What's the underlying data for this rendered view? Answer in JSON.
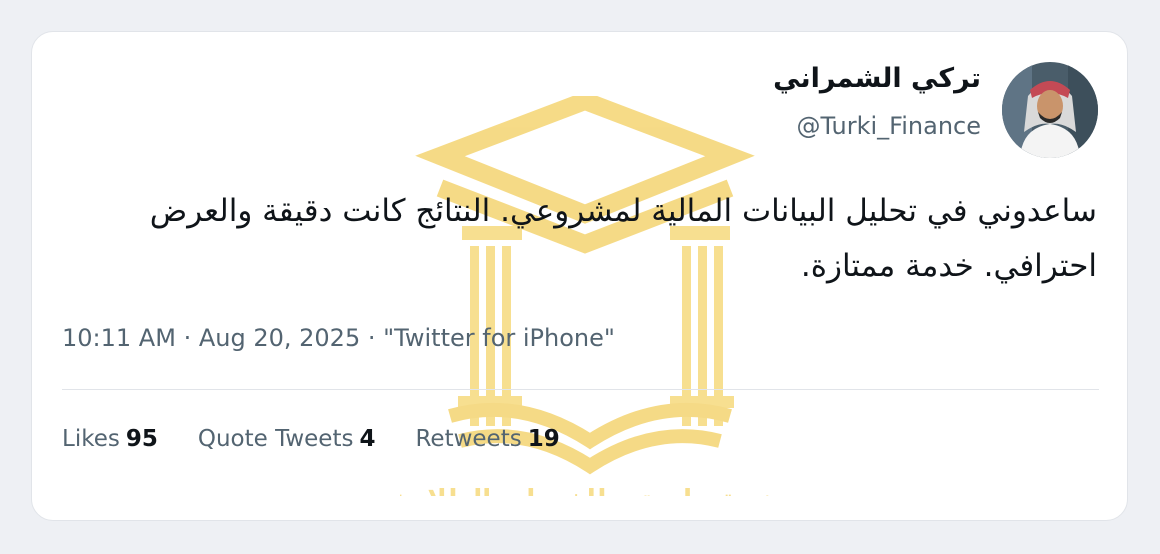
{
  "tweet": {
    "author": {
      "display_name": "تركي الشمراني",
      "handle": "@Turki_Finance",
      "avatar_icon": "user-avatar-photo"
    },
    "text": "ساعدوني في تحليل البيانات المالية لمشروعي. النتائج كانت دقيقة والعرض احترافي. خدمة ممتازة.",
    "meta": {
      "time": "10:11 AM",
      "date": "Aug 20, 2025",
      "source": "\"Twitter for iPhone\"",
      "separator": "·"
    },
    "stats": {
      "likes_label": "Likes",
      "likes_value": "95",
      "quotes_label": "Quote Tweets",
      "quotes_value": "4",
      "retweets_label": "Retweets",
      "retweets_value": "19"
    }
  },
  "watermark": {
    "text": "منصة جامعتي للخدمات الطلابية",
    "icon": "graduation-cap-book-logo",
    "color": "#f2c84a"
  },
  "colors": {
    "background": "#eef0f4",
    "card": "#ffffff",
    "primary_text": "#0f1419",
    "secondary_text": "#536471"
  }
}
